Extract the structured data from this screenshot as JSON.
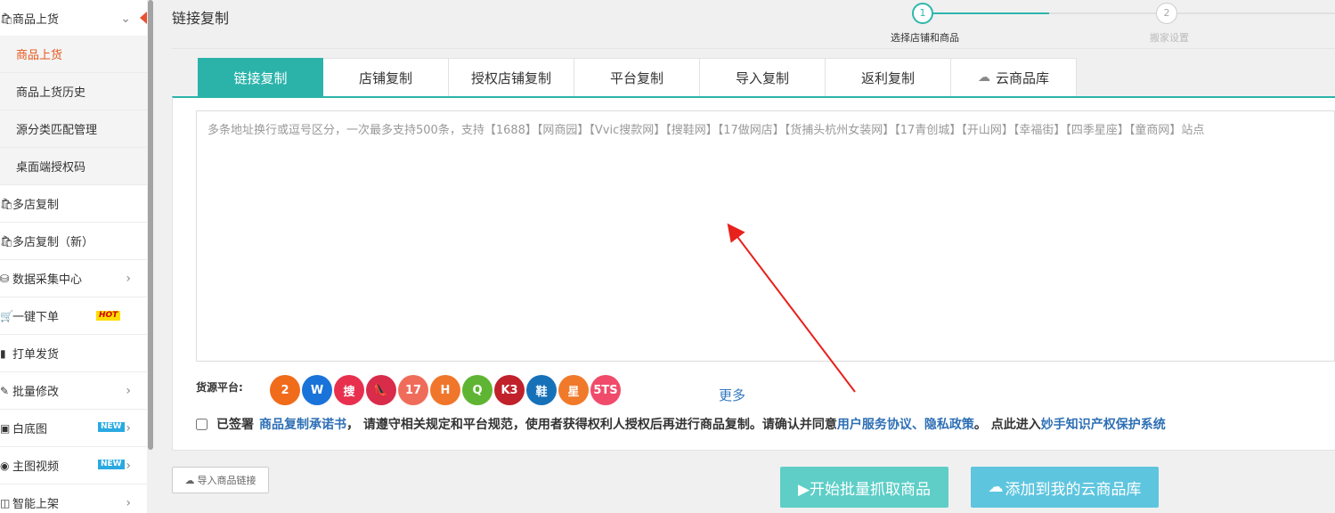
{
  "sidebar": {
    "section": {
      "label": "商品上货",
      "icon": "bag-icon"
    },
    "sub_items": [
      {
        "label": "商品上货",
        "active": true
      },
      {
        "label": "商品上货历史"
      },
      {
        "label": "源分类匹配管理"
      },
      {
        "label": "桌面端授权码"
      }
    ],
    "items": [
      {
        "label": "多店复制",
        "icon": "bag-icon"
      },
      {
        "label": "多店复制（新）",
        "icon": "bag-icon"
      },
      {
        "label": "数据采集中心",
        "icon": "database-icon"
      },
      {
        "label": "一键下单",
        "icon": "cart-icon",
        "badge": "HOT"
      },
      {
        "label": "打单发货",
        "icon": "barcode-icon"
      },
      {
        "label": "批量修改",
        "icon": "edit-icon"
      },
      {
        "label": "白底图",
        "icon": "image-icon",
        "badge": "NEW"
      },
      {
        "label": "主图视频",
        "icon": "play-icon",
        "badge": "NEW"
      },
      {
        "label": "智能上架",
        "icon": "shelf-icon"
      }
    ]
  },
  "header": {
    "title": "链接复制",
    "steps": [
      {
        "num": "1",
        "label": "选择店铺和商品"
      },
      {
        "num": "2",
        "label": "搬家设置"
      }
    ]
  },
  "tabs": [
    "链接复制",
    "店铺复制",
    "授权店铺复制",
    "平台复制",
    "导入复制",
    "返利复制",
    "云商品库"
  ],
  "textarea": {
    "placeholder": "多条地址换行或逗号区分，一次最多支持500条，支持【1688】【网商园】【Vvic搜款网】【搜鞋网】【17做网店】【货捕头杭州女装网】【17青创城】【开山网】【幸福街】【四季星座】【童商网】站点"
  },
  "sources": {
    "label": "货源平台:",
    "logos": [
      {
        "text": "2",
        "name": "1688",
        "color": "#f06b1a"
      },
      {
        "text": "W",
        "name": "网商园",
        "color": "#1a73d9"
      },
      {
        "text": "搜",
        "name": "搜鞋网",
        "color": "#e8304e"
      },
      {
        "text": "👠",
        "name": "鞋",
        "color": "#d92b4a"
      },
      {
        "text": "17",
        "name": "17做网店",
        "color": "#f06c5a"
      },
      {
        "text": "H",
        "name": "货捕头",
        "color": "#f0762b"
      },
      {
        "text": "Q",
        "name": "17青创城",
        "color": "#5fb533"
      },
      {
        "text": "K3",
        "name": "开山网",
        "color": "#c0212a"
      },
      {
        "text": "鞋",
        "name": "搜鞋",
        "color": "#1771b8"
      },
      {
        "text": "星",
        "name": "四季星座",
        "color": "#f07a2a"
      },
      {
        "text": "5TS",
        "name": "5TS",
        "color": "#f04b6a"
      }
    ],
    "more": "更多"
  },
  "agreement": {
    "text1": "已签署",
    "link1": "商品复制承诺书",
    "text2": "， 请遵守相关规定和平台规范，使用者获得权利人授权后再进行商品复制。请确认并同意",
    "link2": "用户服务协议",
    "sep": "、",
    "link3": "隐私政策",
    "text3": "。 点此进入",
    "link4": "妙手知识产权保护系统"
  },
  "buttons": {
    "import": "导入商品链接",
    "start": "▶开始批量抓取商品",
    "cloud": "添加到我的云商品库"
  },
  "colors": {
    "accent": "#2bb3aa",
    "active_menu": "#e8571d",
    "link": "#2e6fb5",
    "annotation_arrow": "#e8211c"
  }
}
